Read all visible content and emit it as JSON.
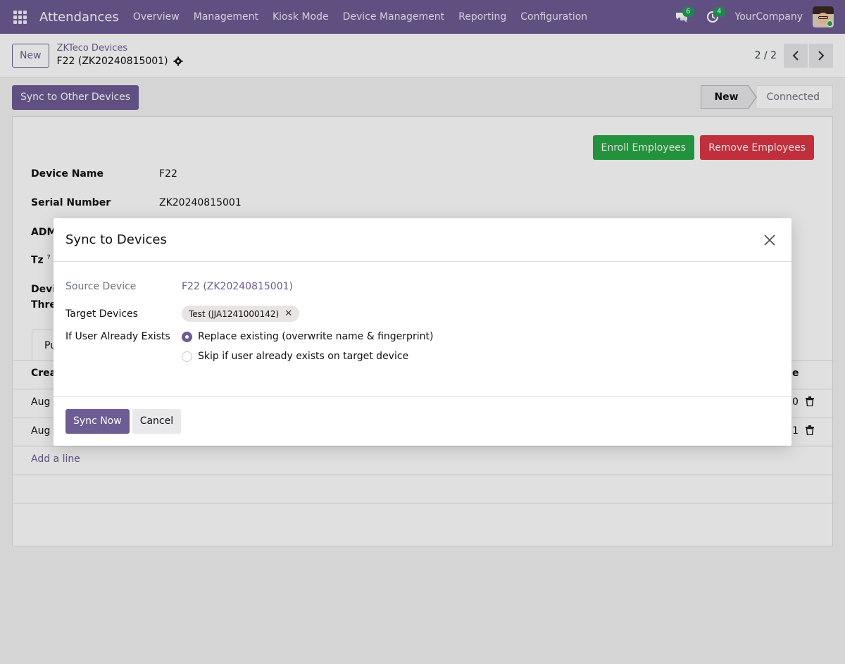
{
  "navbar": {
    "app_name": "Attendances",
    "menu": [
      "Overview",
      "Management",
      "Kiosk Mode",
      "Device Management",
      "Reporting",
      "Configuration"
    ],
    "messages_count": "6",
    "activities_count": "4",
    "company": "YourCompany"
  },
  "control_panel": {
    "new_label": "New",
    "breadcrumb_parent": "ZKTeco Devices",
    "breadcrumb_current": "F22 (ZK20240815001)",
    "pager": "2 / 2"
  },
  "statusbar": {
    "sync_other_label": "Sync to Other Devices",
    "steps": [
      "New",
      "Connected"
    ]
  },
  "sheet": {
    "enroll_label": "Enroll Employees",
    "remove_label": "Remove Employees",
    "fields": [
      {
        "label": "Device Name",
        "value": "F22"
      },
      {
        "label": "Serial Number",
        "value": "ZK20240815001"
      },
      {
        "label": "ADM",
        "value": ""
      },
      {
        "label": "Tz",
        "value": ""
      },
      {
        "label": "Devi",
        "value": ""
      },
      {
        "label": "Thre",
        "value": ""
      }
    ],
    "tz_help": "?",
    "tab_label": "Pu",
    "table_header_left": "Crea",
    "table_header_right": "e",
    "rows": [
      {
        "left": "Aug",
        "right": "0"
      },
      {
        "left": "Aug",
        "right": "1"
      }
    ],
    "add_line_label": "Add a line"
  },
  "modal": {
    "title": "Sync to Devices",
    "source_label": "Source Device",
    "source_value": "F22 (ZK20240815001)",
    "target_label": "Target Devices",
    "target_tag": "Test (JJA1241000142)",
    "exists_label": "If User Already Exists",
    "options": [
      {
        "label": "Replace existing (overwrite name & fingerprint)",
        "checked": true
      },
      {
        "label": "Skip if user already exists on target device",
        "checked": false
      }
    ],
    "sync_now_label": "Sync Now",
    "cancel_label": "Cancel"
  },
  "colors": {
    "brand": "#6e5c94",
    "success": "#28a745",
    "danger": "#dc3545"
  }
}
